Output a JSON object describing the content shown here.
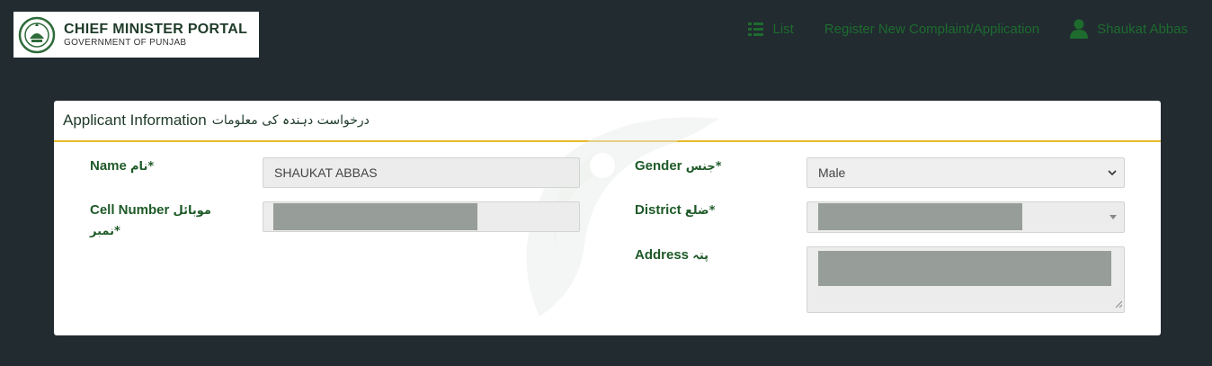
{
  "header": {
    "logo_title": "CHIEF MINISTER PORTAL",
    "logo_subtitle": "GOVERNMENT OF PUNJAB",
    "nav": {
      "list_label": "List",
      "register_label": "Register New Complaint/Application",
      "user_label": "Shaukat Abbas"
    }
  },
  "card": {
    "title": "Applicant Information",
    "title_urdu": "درخواست دہندہ کی معلومات",
    "name": {
      "label": "Name",
      "label_urdu": "نام*",
      "value": "SHAUKAT ABBAS"
    },
    "cell": {
      "label": "Cell Number",
      "label_urdu": "موبائل",
      "label_urdu2": "نمبر*"
    },
    "gender": {
      "label": "Gender",
      "label_urdu": "جنس*",
      "value": "Male"
    },
    "district": {
      "label": "District",
      "label_urdu": "ضلع*"
    },
    "address": {
      "label": "Address",
      "label_urdu": "پتہ"
    }
  },
  "colors": {
    "nav_green": "#1e6b2e",
    "accent": "#e6b92c",
    "background": "#212b30"
  }
}
